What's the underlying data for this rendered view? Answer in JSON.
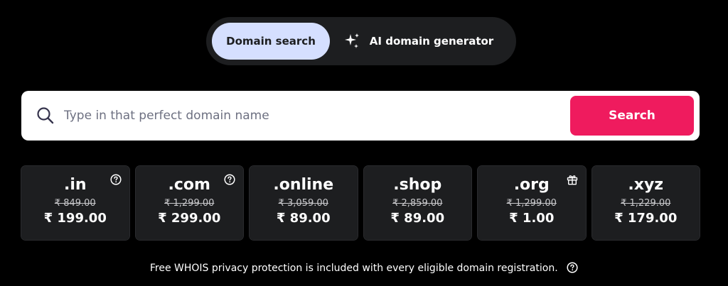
{
  "toggle": {
    "domain_search_label": "Domain search",
    "ai_generator_label": "AI domain generator"
  },
  "search": {
    "placeholder": "Type in that perfect domain name",
    "value": "",
    "button_label": "Search"
  },
  "currency_symbol": "₹",
  "tlds": [
    {
      "name": ".in",
      "old_price": "₹ 849.00",
      "price": "₹ 199.00",
      "badge_icon": "help-circle-icon"
    },
    {
      "name": ".com",
      "old_price": "₹ 1,299.00",
      "price": "₹ 299.00",
      "badge_icon": "help-circle-icon"
    },
    {
      "name": ".online",
      "old_price": "₹ 3,059.00",
      "price": "₹ 89.00",
      "badge_icon": ""
    },
    {
      "name": ".shop",
      "old_price": "₹ 2,859.00",
      "price": "₹ 89.00",
      "badge_icon": ""
    },
    {
      "name": ".org",
      "old_price": "₹ 1,299.00",
      "price": "₹ 1.00",
      "badge_icon": "gift-icon"
    },
    {
      "name": ".xyz",
      "old_price": "₹ 1,229.00",
      "price": "₹ 179.00",
      "badge_icon": ""
    }
  ],
  "footer": {
    "note": "Free WHOIS privacy protection is included with every eligible domain registration."
  },
  "colors": {
    "background": "#000000",
    "toggle_bg": "#1d1e20",
    "active_tab": "#d5dfff",
    "search_button": "#ef1b5e",
    "card_bg": "#1d1e20"
  }
}
